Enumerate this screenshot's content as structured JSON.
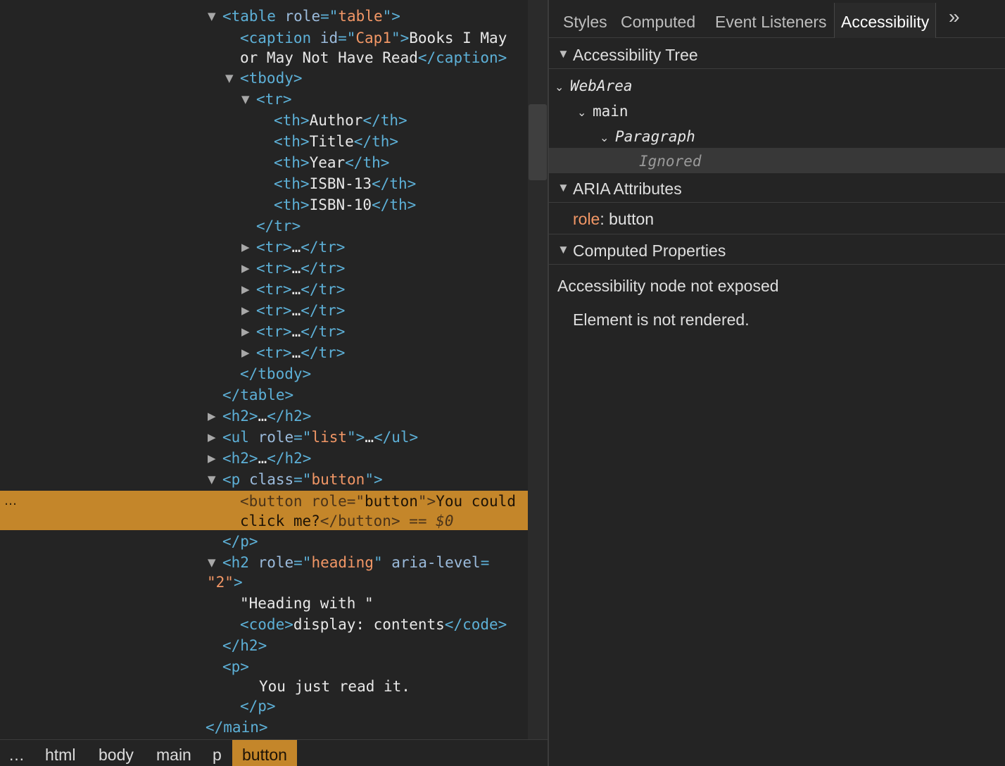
{
  "elements": {
    "lines": [
      {
        "tri": "▼",
        "seg": [
          [
            "tag",
            "<table "
          ],
          [
            "an",
            "role"
          ],
          [
            "tag",
            "=\""
          ],
          [
            "av",
            "table"
          ],
          [
            "tag",
            "\">"
          ]
        ]
      },
      {
        "tri": "",
        "seg": [
          [
            "tag",
            "<caption "
          ],
          [
            "an",
            "id"
          ],
          [
            "tag",
            "=\""
          ],
          [
            "av",
            "Cap1"
          ],
          [
            "tag",
            "\">"
          ],
          [
            "tx",
            "Books I May"
          ]
        ]
      },
      {
        "tri": "",
        "seg": [
          [
            "tx",
            "or May Not Have Read"
          ],
          [
            "tag",
            "</caption>"
          ]
        ]
      },
      {
        "tri": "▼",
        "seg": [
          [
            "tag",
            "<tbody>"
          ]
        ]
      },
      {
        "tri": "▼",
        "seg": [
          [
            "tag",
            "<tr>"
          ]
        ]
      },
      {
        "tri": "",
        "seg": [
          [
            "tag",
            "<th>"
          ],
          [
            "tx",
            "Author"
          ],
          [
            "tag",
            "</th>"
          ]
        ]
      },
      {
        "tri": "",
        "seg": [
          [
            "tag",
            "<th>"
          ],
          [
            "tx",
            "Title"
          ],
          [
            "tag",
            "</th>"
          ]
        ]
      },
      {
        "tri": "",
        "seg": [
          [
            "tag",
            "<th>"
          ],
          [
            "tx",
            "Year"
          ],
          [
            "tag",
            "</th>"
          ]
        ]
      },
      {
        "tri": "",
        "seg": [
          [
            "tag",
            "<th>"
          ],
          [
            "tx",
            "ISBN-13"
          ],
          [
            "tag",
            "</th>"
          ]
        ]
      },
      {
        "tri": "",
        "seg": [
          [
            "tag",
            "<th>"
          ],
          [
            "tx",
            "ISBN-10"
          ],
          [
            "tag",
            "</th>"
          ]
        ]
      },
      {
        "tri": "",
        "seg": [
          [
            "tag",
            "</tr>"
          ]
        ]
      },
      {
        "tri": "▶",
        "seg": [
          [
            "tag",
            "<tr>"
          ],
          [
            "tx",
            "…"
          ],
          [
            "tag",
            "</tr>"
          ]
        ]
      },
      {
        "tri": "▶",
        "seg": [
          [
            "tag",
            "<tr>"
          ],
          [
            "tx",
            "…"
          ],
          [
            "tag",
            "</tr>"
          ]
        ]
      },
      {
        "tri": "▶",
        "seg": [
          [
            "tag",
            "<tr>"
          ],
          [
            "tx",
            "…"
          ],
          [
            "tag",
            "</tr>"
          ]
        ]
      },
      {
        "tri": "▶",
        "seg": [
          [
            "tag",
            "<tr>"
          ],
          [
            "tx",
            "…"
          ],
          [
            "tag",
            "</tr>"
          ]
        ]
      },
      {
        "tri": "▶",
        "seg": [
          [
            "tag",
            "<tr>"
          ],
          [
            "tx",
            "…"
          ],
          [
            "tag",
            "</tr>"
          ]
        ]
      },
      {
        "tri": "▶",
        "seg": [
          [
            "tag",
            "<tr>"
          ],
          [
            "tx",
            "…"
          ],
          [
            "tag",
            "</tr>"
          ]
        ]
      },
      {
        "tri": "",
        "seg": [
          [
            "tag",
            "</tbody>"
          ]
        ]
      },
      {
        "tri": "",
        "seg": [
          [
            "tag",
            "</table>"
          ]
        ]
      },
      {
        "tri": "▶",
        "seg": [
          [
            "tag",
            "<h2>"
          ],
          [
            "tx",
            "…"
          ],
          [
            "tag",
            "</h2>"
          ]
        ]
      },
      {
        "tri": "▶",
        "seg": [
          [
            "tag",
            "<ul "
          ],
          [
            "an",
            "role"
          ],
          [
            "tag",
            "=\""
          ],
          [
            "av",
            "list"
          ],
          [
            "tag",
            "\">"
          ],
          [
            "tx",
            "…"
          ],
          [
            "tag",
            "</ul>"
          ]
        ]
      },
      {
        "tri": "▶",
        "seg": [
          [
            "tag",
            "<h2>"
          ],
          [
            "tx",
            "…"
          ],
          [
            "tag",
            "</h2>"
          ]
        ]
      },
      {
        "tri": "▼",
        "seg": [
          [
            "tag",
            "<p "
          ],
          [
            "an",
            "class"
          ],
          [
            "tag",
            "=\""
          ],
          [
            "av",
            "button"
          ],
          [
            "tag",
            "\">"
          ]
        ]
      },
      {
        "tri": "",
        "seg": [
          [
            "tag",
            "</p>"
          ]
        ]
      },
      {
        "tri": "▼",
        "seg": [
          [
            "tag",
            "<h2 "
          ],
          [
            "an",
            "role"
          ],
          [
            "tag",
            "=\""
          ],
          [
            "av",
            "heading"
          ],
          [
            "tag",
            "\" "
          ],
          [
            "an",
            "aria-level"
          ],
          [
            "tag",
            "="
          ]
        ]
      },
      {
        "tri": "",
        "seg": [
          [
            "av",
            "\"2\""
          ],
          [
            "tag",
            ">"
          ]
        ]
      },
      {
        "tri": "",
        "seg": [
          [
            "tx",
            "\"Heading with \""
          ]
        ]
      },
      {
        "tri": "",
        "seg": [
          [
            "tag",
            "<code>"
          ],
          [
            "tx",
            "display: contents"
          ],
          [
            "tag",
            "</code>"
          ]
        ]
      },
      {
        "tri": "",
        "seg": [
          [
            "tag",
            "</h2>"
          ]
        ]
      },
      {
        "tri": "",
        "seg": [
          [
            "tag",
            "<p>"
          ]
        ]
      },
      {
        "tri": "",
        "seg": [
          [
            "tx",
            "You just read it."
          ]
        ]
      },
      {
        "tri": "",
        "seg": [
          [
            "tag",
            "</p>"
          ]
        ]
      },
      {
        "tri": "",
        "seg": [
          [
            "tag",
            "</main>"
          ]
        ]
      }
    ],
    "selected": {
      "line1": [
        [
          "tag",
          "<button "
        ],
        [
          "an",
          "role"
        ],
        [
          "tag",
          "=\""
        ],
        [
          "av",
          "button"
        ],
        [
          "tag",
          "\">"
        ],
        [
          "tx",
          "You could"
        ]
      ],
      "line2": [
        [
          "tx",
          "click me?"
        ],
        [
          "tag",
          "</button>"
        ],
        [
          "tag",
          " == "
        ],
        [
          "dim",
          "$0"
        ]
      ]
    },
    "selected_dots": "…"
  },
  "breadcrumbs": [
    "…",
    "html",
    "body",
    "main",
    "p",
    "button"
  ],
  "sidebar": {
    "tabs": [
      "Styles",
      "Computed",
      "Event Listeners",
      "Accessibility"
    ],
    "active_tab": "Accessibility",
    "more_icon": "»",
    "sections": {
      "tree": "Accessibility Tree",
      "aria": "ARIA Attributes",
      "computed": "Computed Properties"
    },
    "tree": {
      "webarea": "WebArea",
      "main": "main",
      "paragraph": "Paragraph",
      "ignored": "Ignored"
    },
    "aria": {
      "key": "role",
      "sep": ": ",
      "value": "button"
    },
    "computed": {
      "message": "Accessibility node not exposed",
      "detail": "Element is not rendered."
    }
  },
  "colors": {
    "selection": "#c4862a",
    "tag": "#5db0d7",
    "attr_value": "#f29766",
    "background": "#242424"
  }
}
